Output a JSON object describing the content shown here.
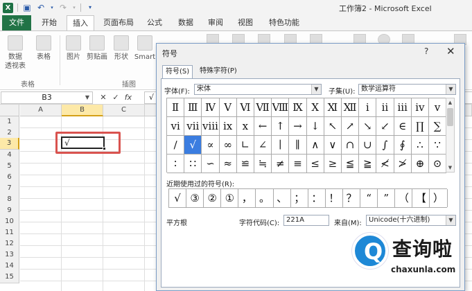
{
  "window": {
    "title": "工作簿2 - Microsoft Excel"
  },
  "ribbon": {
    "tabs": [
      "文件",
      "开始",
      "插入",
      "页面布局",
      "公式",
      "数据",
      "审阅",
      "视图",
      "特色功能"
    ],
    "active_tab": "插入",
    "buttons": {
      "pivot": "数据",
      "pivot2": "透视表",
      "table": "表格",
      "picture": "图片",
      "clipart": "剪贴画",
      "shapes": "形状",
      "smartart": "Smart"
    },
    "groups": {
      "tables": "表格",
      "illustrations": "插图"
    }
  },
  "formula_bar": {
    "name_box": "B3",
    "fx": "fx",
    "content": "√"
  },
  "sheet": {
    "columns": [
      "A",
      "B",
      "C"
    ],
    "rows": [
      "1",
      "2",
      "3",
      "4",
      "5",
      "6",
      "7",
      "8",
      "9",
      "10",
      "11",
      "12",
      "13",
      "14",
      "15"
    ],
    "selected_col": "B",
    "selected_row": "3",
    "cell_value": "√"
  },
  "dialog": {
    "title": "符号",
    "help": "?",
    "close": "✕",
    "tabs": [
      "符号(S)",
      "特殊字符(P)"
    ],
    "font_label": "字体(F):",
    "font_value": "宋体",
    "subset_label": "子集(U):",
    "subset_value": "数学运算符",
    "symbols": [
      [
        "Ⅱ",
        "Ⅲ",
        "Ⅳ",
        "Ⅴ",
        "Ⅵ",
        "Ⅶ",
        "Ⅷ",
        "Ⅸ",
        "Ⅹ",
        "Ⅺ",
        "Ⅻ",
        "ⅰ",
        "ⅱ",
        "ⅲ",
        "ⅳ",
        "ⅴ"
      ],
      [
        "ⅵ",
        "ⅶ",
        "ⅷ",
        "ⅸ",
        "ⅹ",
        "←",
        "↑",
        "→",
        "↓",
        "↖",
        "↗",
        "↘",
        "↙",
        "∈",
        "∏",
        "∑"
      ],
      [
        "∕",
        "√",
        "∝",
        "∞",
        "∟",
        "∠",
        "∣",
        "∥",
        "∧",
        "∨",
        "∩",
        "∪",
        "∫",
        "∮",
        "∴",
        "∵"
      ],
      [
        "∶",
        "∷",
        "∽",
        "≈",
        "≌",
        "≒",
        "≠",
        "≡",
        "≤",
        "≥",
        "≦",
        "≧",
        "≮",
        "≯",
        "⊕",
        "⊙"
      ]
    ],
    "selected_symbol": "√",
    "recent_label": "近期使用过的符号(R):",
    "recent": [
      "√",
      "③",
      "②",
      "①",
      "，",
      "。",
      "、",
      "；",
      "：",
      "！",
      "？",
      "“",
      "”",
      "（",
      "【",
      "）"
    ],
    "char_name": "平方根",
    "code_label": "字符代码(C):",
    "code_value": "221A",
    "from_label": "来自(M):",
    "from_value": "Unicode(十六进制)"
  },
  "watermark": {
    "brand": "查询啦",
    "url": "chaxunla.com",
    "logo_letter": "Q"
  },
  "colors": {
    "excel_green": "#217346",
    "selection_blue": "#3b7de0",
    "highlight_red": "#d9534f"
  }
}
